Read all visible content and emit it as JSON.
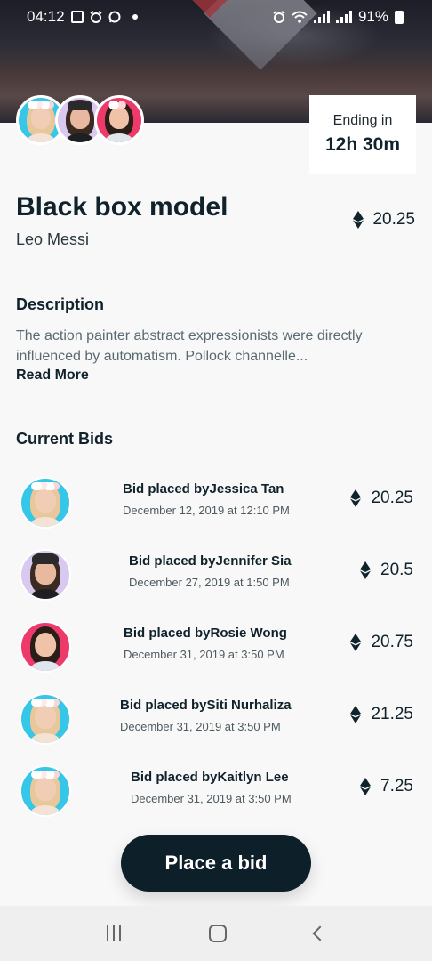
{
  "status_bar": {
    "time": "04:12",
    "battery": "91%"
  },
  "header": {
    "ending_label": "Ending in",
    "ending_value": "12h 30m"
  },
  "item": {
    "title": "Black box model",
    "artist": "Leo Messi",
    "price": "20.25",
    "currency_icon": "ethereum-icon"
  },
  "description": {
    "heading": "Description",
    "text": "The action painter abstract expressionists were directly influenced by automatism. Pollock channelle...",
    "read_more": "Read More"
  },
  "bids": {
    "heading": "Current Bids",
    "items": [
      {
        "who": "Bid placed byJessica Tan",
        "when": "December 12, 2019 at 12:10 PM",
        "amount": "20.25"
      },
      {
        "who": "Bid placed byJennifer Sia",
        "when": "December 27, 2019 at 1:50 PM",
        "amount": "20.5"
      },
      {
        "who": "Bid placed byRosie Wong",
        "when": "December 31, 2019 at 3:50 PM",
        "amount": "20.75"
      },
      {
        "who": "Bid placed bySiti Nurhaliza",
        "when": "December 31, 2019 at 3:50 PM",
        "amount": "21.25"
      },
      {
        "who": "Bid placed byKaitlyn Lee",
        "when": "December 31, 2019 at 3:50 PM",
        "amount": "7.25"
      }
    ]
  },
  "actions": {
    "place_bid": "Place a bid"
  },
  "colors": {
    "primary": "#0d1f28",
    "avatar_blue": "#35c6e8",
    "avatar_purple": "#d9c8f0",
    "avatar_pink": "#ee3a6a"
  }
}
